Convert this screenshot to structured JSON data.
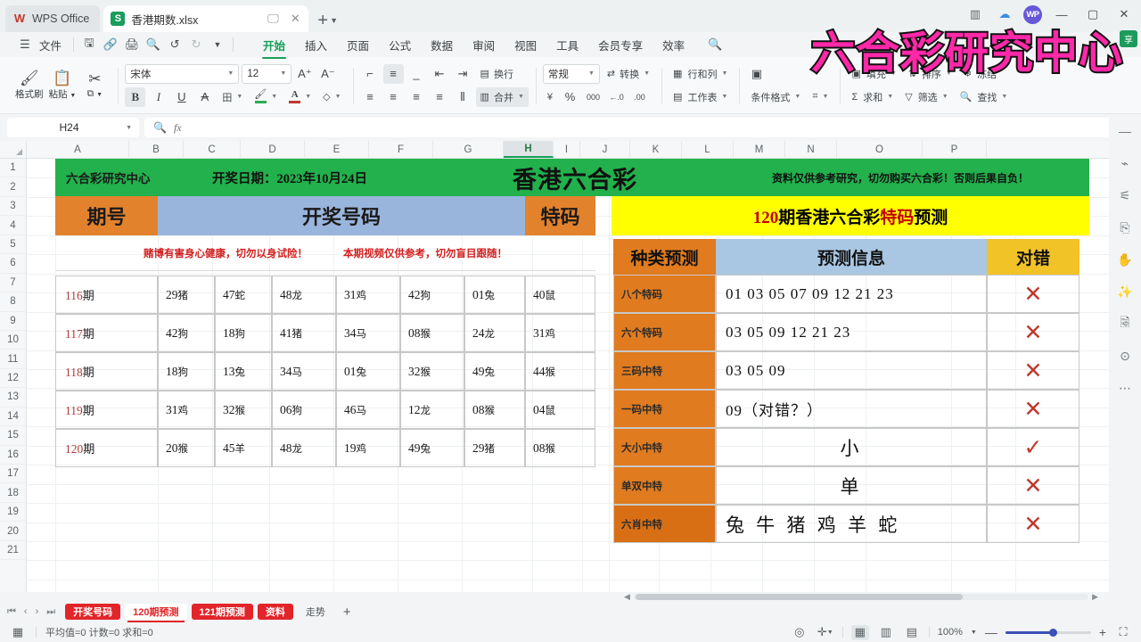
{
  "window": {
    "app_name": "WPS Office",
    "doc_title": "香港期数.xlsx",
    "avatar": "WP",
    "minimize": "—",
    "maximize": "▢",
    "close": "✕"
  },
  "menubar": {
    "file": "文件",
    "items": [
      "开始",
      "插入",
      "页面",
      "公式",
      "数据",
      "审阅",
      "视图",
      "工具",
      "会员专享",
      "效率"
    ],
    "active": "开始",
    "quick_icons": [
      "save-icon",
      "link-icon",
      "print-icon",
      "print-preview-icon",
      "undo-icon",
      "redo-icon",
      "more-icon"
    ],
    "search_icon": "search-icon"
  },
  "ribbon": {
    "format_painter": "格式刷",
    "paste": "粘贴",
    "copy": "复制",
    "cut_icon": "scissors-icon",
    "font_name": "宋体",
    "font_size": "12",
    "grow_font": "A⁺",
    "shrink_font": "A⁻",
    "bold": "B",
    "italic": "I",
    "underline": "U",
    "strikethrough": "A",
    "borders": "田",
    "fill_color": "A",
    "font_color": "A",
    "clear_format": "◇",
    "wrap_text": "换行",
    "merge": "合并",
    "number_format": "常规",
    "convert": "转换",
    "currency": "¥",
    "percent": "%",
    "comma": "000",
    "inc_decimal": "←.0",
    "dec_decimal": ".00",
    "rows_cols": "行和列",
    "worksheet": "工作表",
    "cond_format": "条件格式",
    "table_style": "表格样式",
    "fill": "填充",
    "sort": "排序",
    "freeze": "冻结",
    "autosum": "求和",
    "filter": "筛选",
    "find": "查找"
  },
  "formula_bar": {
    "name_box": "H24",
    "formula_value": "",
    "zoom_icon": "zoom-icon",
    "fx_label": "fx"
  },
  "grid": {
    "columns": [
      "A",
      "B",
      "C",
      "D",
      "E",
      "F",
      "G",
      "H",
      "I",
      "J",
      "K",
      "L",
      "M",
      "N",
      "O",
      "P"
    ],
    "selected_column": "H",
    "rows": [
      "1",
      "2",
      "3",
      "4",
      "5",
      "6",
      "7",
      "8",
      "9",
      "10",
      "11",
      "12",
      "13",
      "14",
      "15",
      "16",
      "17",
      "18",
      "19",
      "20",
      "21"
    ]
  },
  "sheet_content": {
    "banner": {
      "brand": "六合彩研究中心",
      "draw_date": "开奖日期：2023年10月24日",
      "big_title": "香港六合彩",
      "warning": "资料仅供参考研究，切勿购买六合彩！否则后果自负！"
    },
    "left_table": {
      "headers": [
        "期号",
        "开奖号码",
        "特码"
      ],
      "notice_left": "赌博有害身心健康，切勿以身试险！",
      "notice_right": "本期视频仅供参考，切勿盲目跟随！",
      "rows": [
        {
          "period": "116期",
          "numbers": [
            "29猪",
            "47蛇",
            "48龙",
            "31鸡",
            "42狗",
            "01兔"
          ],
          "special": "40鼠"
        },
        {
          "period": "117期",
          "numbers": [
            "42狗",
            "18狗",
            "41猪",
            "34马",
            "08猴",
            "24龙"
          ],
          "special": "31鸡"
        },
        {
          "period": "118期",
          "numbers": [
            "18狗",
            "13兔",
            "34马",
            "01兔",
            "32猴",
            "49兔"
          ],
          "special": "44猴"
        },
        {
          "period": "119期",
          "numbers": [
            "31鸡",
            "32猴",
            "06狗",
            "46马",
            "12龙",
            "08猴"
          ],
          "special": "04鼠"
        },
        {
          "period": "120期",
          "numbers": [
            "20猴",
            "45羊",
            "48龙",
            "19鸡",
            "49兔",
            "29猪"
          ],
          "special": "08猴"
        }
      ]
    },
    "right_panel": {
      "yellow_title_prefix": "120",
      "yellow_title_mid": "期香港六合彩",
      "yellow_title_red": "特码",
      "yellow_title_suffix": "预测",
      "headers": [
        "种类预测",
        "预测信息",
        "对错"
      ],
      "rows": [
        {
          "type": "八个特码",
          "info": "01  03  05  07  09  12  21  23",
          "result": "✕",
          "align": "left",
          "big": false
        },
        {
          "type": "六个特码",
          "info": "03  05  09  12  21  23",
          "result": "✕",
          "align": "left",
          "big": false
        },
        {
          "type": "三码中特",
          "info": "03  05  09",
          "result": "✕",
          "align": "left",
          "big": false
        },
        {
          "type": "一码中特",
          "info": "09（对错？）",
          "result": "✕",
          "align": "left",
          "big": false
        },
        {
          "type": "大小中特",
          "info": "小",
          "result": "✓",
          "align": "center",
          "big": true
        },
        {
          "type": "单双中特",
          "info": "单",
          "result": "✕",
          "align": "center",
          "big": true
        },
        {
          "type": "六肖中特",
          "info": "兔 牛 猪 鸡 羊 蛇",
          "result": "✕",
          "align": "left",
          "big": true
        }
      ]
    }
  },
  "watermark": "六合彩研究中心",
  "right_sidebar": {
    "icons": [
      "collapse-icon",
      "cursor-icon",
      "settings-slider-icon",
      "cell-format-icon",
      "hand-tool-icon",
      "magic-wand-icon",
      "document-search-icon",
      "help-icon",
      "more-options-icon"
    ]
  },
  "sheet_tabs": {
    "nav": [
      "⏮",
      "‹",
      "›",
      "⏭"
    ],
    "tabs": [
      {
        "label": "开奖号码",
        "active": false,
        "style": "red"
      },
      {
        "label": "120期预测",
        "active": true,
        "style": "red"
      },
      {
        "label": "121期预测",
        "active": false,
        "style": "red"
      },
      {
        "label": "资料",
        "active": false,
        "style": "red"
      },
      {
        "label": "走势",
        "active": false,
        "style": "plain"
      }
    ],
    "add": "+"
  },
  "status_bar": {
    "left_icon": "cell-mode-icon",
    "stats": "平均值=0  计数=0  求和=0",
    "view_icons": [
      "eye-icon",
      "crosshair-icon",
      "normal-view-icon",
      "page-layout-icon",
      "page-break-icon"
    ],
    "zoom_level": "100%",
    "zoom_out": "—",
    "zoom_in": "+",
    "fullscreen_icon": "fullscreen-icon"
  },
  "colors": {
    "banner_green": "#22b14c",
    "header_orange": "#e3822c",
    "header_blue": "#9ab5dc",
    "yellow": "#ffff00",
    "gold": "#f2c327",
    "light_blue": "#a9c7e3",
    "red_text": "#c00000",
    "notice_red": "#d21f1f",
    "watermark_pink": "#ff28a8",
    "tab_red": "#e2252a",
    "accent_green": "#18a058"
  }
}
